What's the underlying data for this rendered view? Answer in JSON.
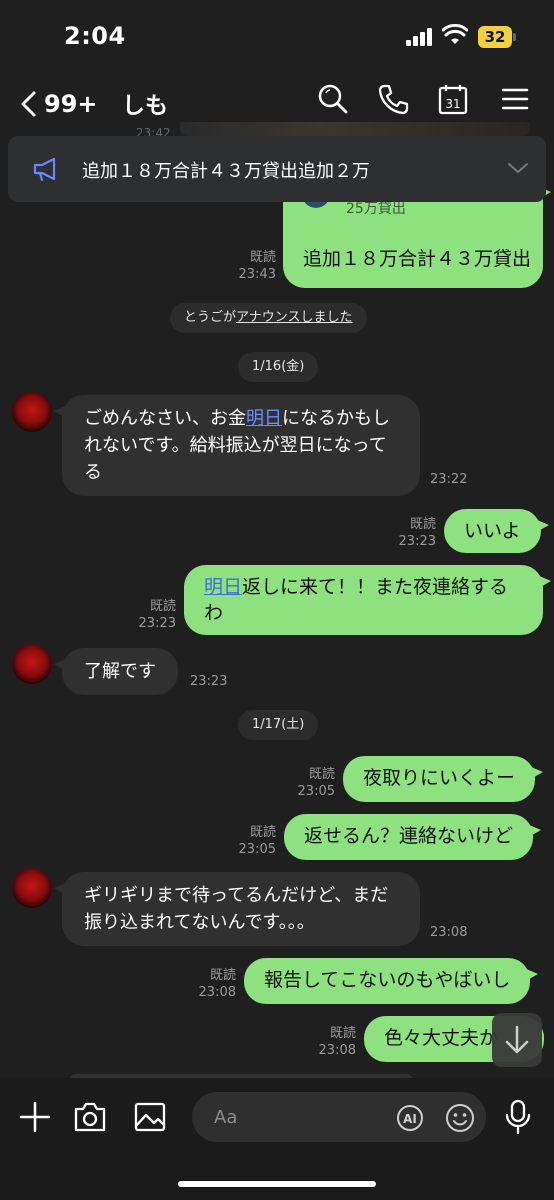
{
  "status": {
    "time": "2:04",
    "battery": "32"
  },
  "header": {
    "back_count": "99+",
    "title": "しも"
  },
  "announcement": {
    "text": "追加１８万合計４３万貸出追加２万"
  },
  "top_fragment": {
    "faded_timestamp": "23:42",
    "quoted_text": "25万貸出"
  },
  "messages": {
    "m1": {
      "text": "追加１８万合計４３万貸出",
      "read": "既読",
      "time": "23:43"
    },
    "system": {
      "prefix": "とうごが",
      "link": "アナウンスしました"
    },
    "date1": "1/16(金)",
    "m2": {
      "pre": "ごめんなさい、お金",
      "link": "明日",
      "post": "になるかもしれないです。給料振込が翌日になってる",
      "time": "23:22"
    },
    "m3": {
      "text": "いいよ",
      "read": "既読",
      "time": "23:23"
    },
    "m4": {
      "link": "明日",
      "post": "返しに来て！！また夜連絡するわ",
      "read": "既読",
      "time": "23:23"
    },
    "m5": {
      "text": "了解です",
      "time": "23:23"
    },
    "date2": "1/17(土)",
    "m6": {
      "text": "夜取りにいくよー",
      "read": "既読",
      "time": "23:05"
    },
    "m7": {
      "text": "返せるん？連絡ないけど",
      "read": "既読",
      "time": "23:05"
    },
    "m8": {
      "text": "ギリギリまで待ってるんだけど、まだ振り込まれてないんです。。。",
      "time": "23:08"
    },
    "m9": {
      "text": "報告してこないのもやばいし",
      "read": "既読",
      "time": "23:08"
    },
    "m10": {
      "text": "色々大丈夫か",
      "read": "既読",
      "time": "23:08"
    }
  },
  "input": {
    "placeholder": "Aa"
  },
  "colors": {
    "sent_bubble": "#8ee17f",
    "received_bubble": "#303030",
    "background": "#1f1f1f",
    "link": "#3b6fd8"
  }
}
